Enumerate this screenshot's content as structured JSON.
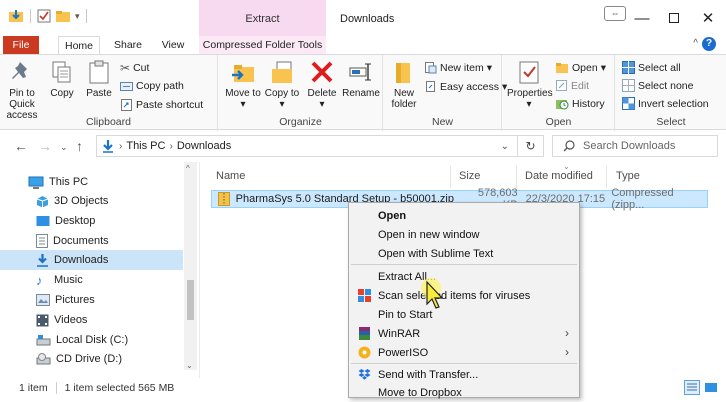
{
  "window": {
    "title": "Downloads",
    "context_tab_group": "Extract"
  },
  "tabs": [
    "File",
    "Home",
    "Share",
    "View",
    "Compressed Folder Tools"
  ],
  "ribbon": {
    "clipboard": {
      "label": "Clipboard",
      "pin": "Pin to Quick access",
      "copy": "Copy",
      "paste": "Paste",
      "cut": "Cut",
      "copy_path": "Copy path",
      "paste_shortcut": "Paste shortcut"
    },
    "organize": {
      "label": "Organize",
      "move_to": "Move to",
      "copy_to": "Copy to",
      "delete": "Delete",
      "rename": "Rename"
    },
    "new": {
      "label": "New",
      "new_folder": "New folder",
      "new_item": "New item",
      "easy_access": "Easy access"
    },
    "open": {
      "label": "Open",
      "properties": "Properties",
      "open": "Open",
      "edit": "Edit",
      "history": "History"
    },
    "select": {
      "label": "Select",
      "select_all": "Select all",
      "select_none": "Select none",
      "invert_selection": "Invert selection"
    }
  },
  "address": {
    "crumbs": [
      "This PC",
      "Downloads"
    ],
    "search_placeholder": "Search Downloads"
  },
  "nav_pane": [
    {
      "label": "This PC",
      "icon": "pc-icon"
    },
    {
      "label": "3D Objects",
      "icon": "3d-objects-icon"
    },
    {
      "label": "Desktop",
      "icon": "desktop-icon"
    },
    {
      "label": "Documents",
      "icon": "documents-icon"
    },
    {
      "label": "Downloads",
      "icon": "downloads-icon"
    },
    {
      "label": "Music",
      "icon": "music-icon"
    },
    {
      "label": "Pictures",
      "icon": "pictures-icon"
    },
    {
      "label": "Videos",
      "icon": "videos-icon"
    },
    {
      "label": "Local Disk (C:)",
      "icon": "local-disk-icon"
    },
    {
      "label": "CD Drive (D:)",
      "icon": "cd-drive-icon"
    }
  ],
  "file_list": {
    "columns": [
      "Name",
      "Size",
      "Date modified",
      "Type"
    ],
    "rows": [
      {
        "name": "PharmaSys 5.0 Standard Setup - b50001.zip",
        "size": "578,603 KB",
        "date": "22/3/2020 17:15",
        "type": "Compressed (zipp..."
      }
    ]
  },
  "context_menu": {
    "items": [
      {
        "label": "Open"
      },
      {
        "label": "Open in new window"
      },
      {
        "label": "Open with Sublime Text"
      },
      {
        "label": "Extract All..."
      },
      {
        "label": "Scan selected items for viruses"
      },
      {
        "label": "Pin to Start"
      },
      {
        "label": "WinRAR"
      },
      {
        "label": "PowerISO"
      },
      {
        "label": "Send with Transfer..."
      },
      {
        "label": "Move to Dropbox"
      }
    ]
  },
  "status_bar": {
    "item_count": "1 item",
    "selection": "1 item selected  565 MB"
  },
  "colors": {
    "file_tab": "#c93a20",
    "context_tab": "#f7d9f0",
    "selection": "#cce8ff",
    "nav_selected": "#cce4f7"
  }
}
